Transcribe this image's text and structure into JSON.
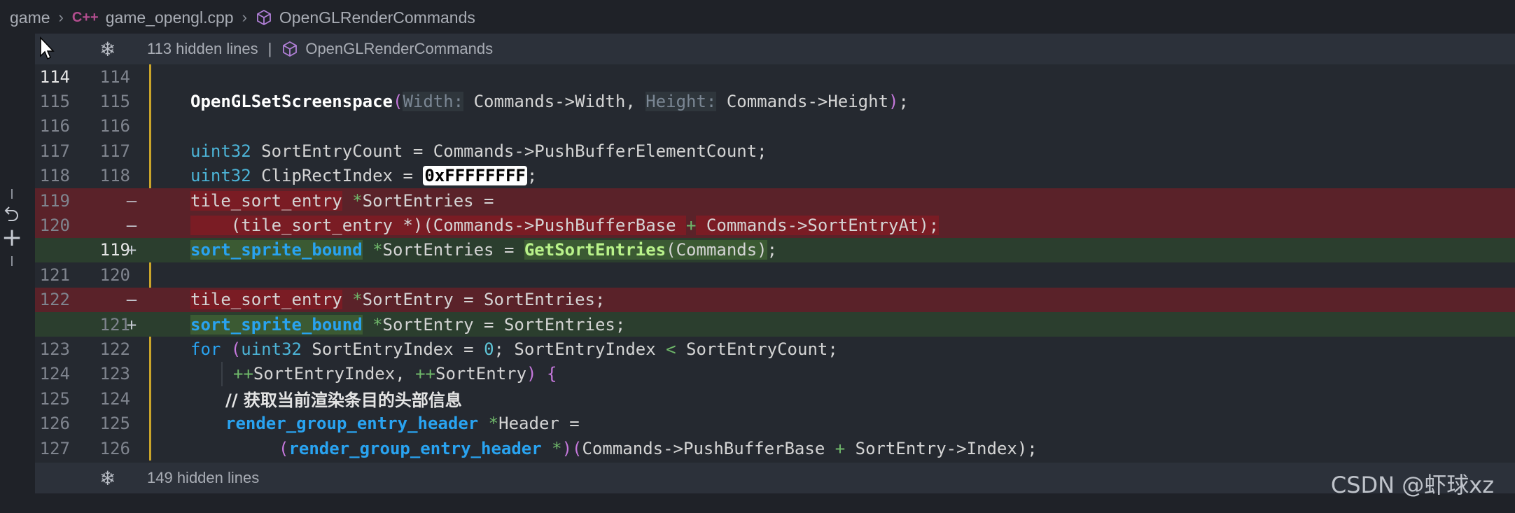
{
  "breadcrumb": {
    "folder": "game",
    "file_icon": "C++",
    "file": "game_opengl.cpp",
    "symbol": "OpenGLRenderCommands"
  },
  "hidden_top": {
    "count_label": "113 hidden lines",
    "separator": "|",
    "symbol": "OpenGLRenderCommands"
  },
  "hidden_bottom": {
    "count_label": "149 hidden lines"
  },
  "rows": [
    {
      "old": "114",
      "new": "114",
      "mark": "",
      "type": "ctx"
    },
    {
      "old": "115",
      "new": "115",
      "mark": "",
      "type": "ctx"
    },
    {
      "old": "116",
      "new": "116",
      "mark": "",
      "type": "ctx"
    },
    {
      "old": "117",
      "new": "117",
      "mark": "",
      "type": "ctx"
    },
    {
      "old": "118",
      "new": "118",
      "mark": "",
      "type": "ctx"
    },
    {
      "old": "119",
      "new": "",
      "mark": "—",
      "type": "del"
    },
    {
      "old": "120",
      "new": "",
      "mark": "—",
      "type": "del"
    },
    {
      "old": "",
      "new": "119",
      "mark": "+",
      "type": "add"
    },
    {
      "old": "121",
      "new": "120",
      "mark": "",
      "type": "ctx"
    },
    {
      "old": "122",
      "new": "",
      "mark": "—",
      "type": "del"
    },
    {
      "old": "",
      "new": "121",
      "mark": "+",
      "type": "add"
    },
    {
      "old": "123",
      "new": "122",
      "mark": "",
      "type": "ctx"
    },
    {
      "old": "124",
      "new": "123",
      "mark": "",
      "type": "ctx"
    },
    {
      "old": "125",
      "new": "124",
      "mark": "",
      "type": "ctx"
    },
    {
      "old": "126",
      "new": "125",
      "mark": "",
      "type": "ctx"
    },
    {
      "old": "127",
      "new": "126",
      "mark": "",
      "type": "ctx"
    }
  ],
  "code": {
    "l115": {
      "fn": "OpenGLSetScreenspace",
      "p1": "Width:",
      "a1": "Commands->Width, ",
      "p2": "Height:",
      "a2": "Commands->Height",
      "end": ");"
    },
    "l117": {
      "type": "uint32",
      "rest": " SortEntryCount = Commands->PushBufferElementCount;"
    },
    "l118": {
      "type": "uint32",
      "rest": " ClipRectIndex = ",
      "hex": "0xFFFFFFFF",
      "end": ";"
    },
    "l119d": {
      "t1": "tile_sort_entry",
      "star": " *",
      "rest": "SortEntries ="
    },
    "l120d": {
      "pre": "    (tile_sort_entry *)(Commands->PushBufferBase ",
      "plus": "+",
      "rest": " Commands->SortEntryAt);"
    },
    "l119a": {
      "type": "sort_sprite_bound",
      "star": " *",
      "mid": "SortEntries = ",
      "fn": "GetSortEntries",
      "args": "(Commands)",
      "end": ";"
    },
    "l122d": {
      "t1": "tile_sort_entry",
      "star": " *",
      "rest": "SortEntry = SortEntries;"
    },
    "l121a": {
      "type": "sort_sprite_bound",
      "star": " *",
      "rest": "SortEntry = SortEntries;"
    },
    "l123": {
      "kw": "for",
      "open": " (",
      "type": "uint32",
      "rest1": " SortEntryIndex = ",
      "num": "0",
      "rest2": "; SortEntryIndex ",
      "lt": "<",
      "rest3": " SortEntryCount;"
    },
    "l124": {
      "pp1": "++",
      "r1": "SortEntryIndex, ",
      "pp2": "++",
      "r2": "SortEntry",
      "close": ") {"
    },
    "l125": {
      "comment": "// 获取当前渲染条目的头部信息"
    },
    "l126": {
      "type": "render_group_entry_header",
      "star": " *",
      "rest": "Header ="
    },
    "l127": {
      "open": "(",
      "type": "render_group_entry_header",
      "star": " *",
      ")": ")",
      "rest": "(Commands->PushBufferBase ",
      "plus": "+",
      "rest2": " SortEntry->Index);"
    }
  },
  "watermark": "CSDN @虾球xz"
}
